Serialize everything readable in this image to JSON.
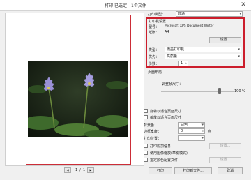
{
  "window": {
    "title": "打印  已选定：1个文件",
    "close_glyph": "✕"
  },
  "preview": {
    "page_current": "1",
    "page_sep": "/",
    "page_total": "1",
    "prev_glyph": "◀",
    "next_glyph": "▶"
  },
  "settings": {
    "print_type_label": "打印类型：",
    "print_type_value": "普通",
    "printer_group_label": "打印机设置",
    "model_label": "型号：",
    "model_value": "Microsoft XPS Document Writer",
    "paper_label": "纸张：",
    "paper_value": "A4",
    "setup_button": "设置...",
    "type_label": "类型：",
    "type_value": "喷墨打印机",
    "quality_label": "优先：",
    "quality_value": "高质量",
    "copies_label": "份数：",
    "copies_value": "1",
    "layout_label": "页面布局",
    "adjust_label": "调整帧尺寸：",
    "scale_value": "100",
    "scale_unit": "%",
    "scale_fraction": 1.0,
    "rotate_label": "旋转以适合页面尺寸",
    "autofit_label": "缩放以适合页面尺寸",
    "bg_color_label": "背景色：",
    "bg_color_value": "白色",
    "margin_label": "边框宽度：",
    "margin_value": "0",
    "margin_unit": "点",
    "print_position_label": "打印位置：",
    "print_info_label": "打印附加信息",
    "print_info_button": "设置...",
    "use_camera_label": "使用图像缩放(草稿模式)",
    "color_profile_label": "指定颜色配置文件",
    "color_profile_button": "设置..."
  },
  "footer": {
    "print_button": "打印",
    "print_to_file_button": "打印到文件...",
    "cancel_button": "取消"
  },
  "colors": {
    "accent_red": "#cc1e2c",
    "frame_red": "#cc2d37"
  }
}
